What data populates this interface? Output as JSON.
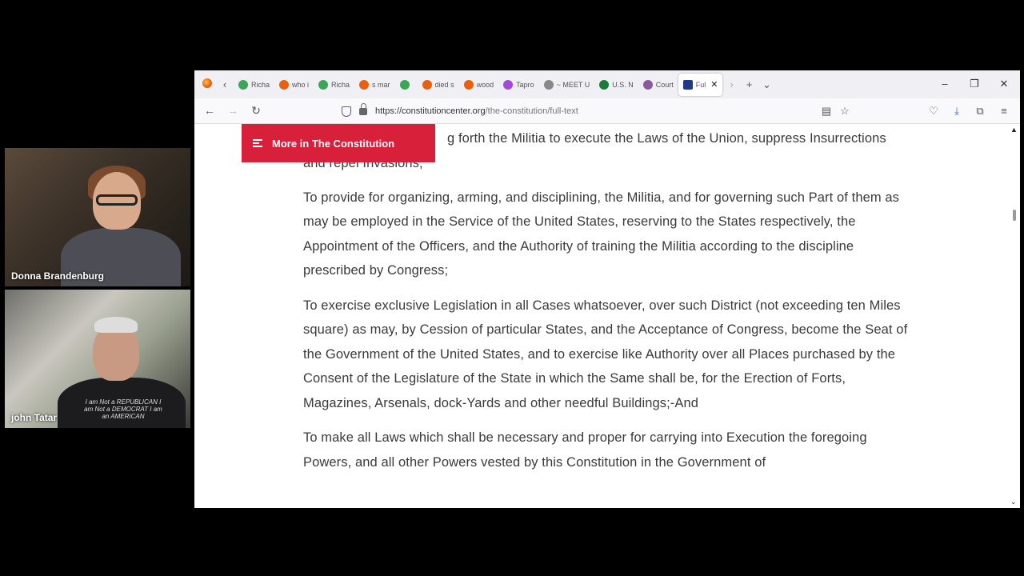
{
  "participants": [
    {
      "name": "Donna Brandenburg"
    },
    {
      "name": "john Tatar",
      "shirt_text": "I am Not a REPUBLICAN I am Not a DEMOCRAT I am an AMERICAN"
    }
  ],
  "browser": {
    "tabs": [
      {
        "label": "Richa",
        "color": "#3aa757"
      },
      {
        "label": "who i",
        "color": "#e8600c"
      },
      {
        "label": "Richa",
        "color": "#3aa757"
      },
      {
        "label": "s mar",
        "color": "#e8600c"
      },
      {
        "label": "",
        "color": "#3aa757"
      },
      {
        "label": "died s",
        "color": "#e8600c"
      },
      {
        "label": "wood",
        "color": "#e8600c"
      },
      {
        "label": "Tapro",
        "color": "#a24bd6"
      },
      {
        "label": "~ MEET U",
        "color": "#888888"
      },
      {
        "label": "U.S. N",
        "color": "#1b7b3a"
      },
      {
        "label": "Court",
        "color": "#8a5aa0"
      },
      {
        "label": "Ful",
        "color": "#1e3a8a",
        "active": true
      }
    ],
    "url_host": "https://constitutioncenter.org",
    "url_path": "/the-constitution/full-text"
  },
  "page": {
    "more_button": "More in The Constitution",
    "paragraphs": [
      "g forth the Militia to execute the Laws of the Union, suppress Insurrections and repel Invasions;",
      "To provide for organizing, arming, and disciplining, the Militia, and for governing such Part of them as may be employed in the Service of the United States, reserving to the States respectively, the Appointment of the Officers, and the Authority of training the Militia according to the discipline prescribed by Congress;",
      "To exercise exclusive Legislation in all Cases whatsoever, over such District (not exceeding ten Miles square) as may, by Cession of particular States, and the Acceptance of Congress, become the Seat of the Government of the United States, and to exercise like Authority over all Places purchased by the Consent of the Legislature of the State in which the Same shall be, for the Erection of Forts, Magazines, Arsenals, dock-Yards and other needful Buildings;-And",
      "To make all Laws which shall be necessary and proper for carrying into Execution the foregoing Powers, and all other Powers vested by this Constitution in the Government of"
    ]
  },
  "colors": {
    "accent": "#d8203a",
    "text": "#3a3a3a"
  }
}
